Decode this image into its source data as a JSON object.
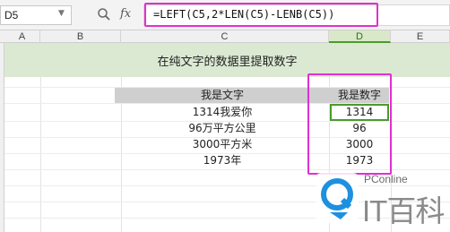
{
  "formula_bar": {
    "name_box": "D5",
    "fx_label": "fx",
    "formula": "=LEFT(C5,2*LEN(C5)-LENB(C5))"
  },
  "columns": [
    "A",
    "B",
    "C",
    "D",
    "E"
  ],
  "banner": "在纯文字的数据里提取数字",
  "table": {
    "header_source": "我是文字",
    "header_result": "我是数字",
    "rows": [
      {
        "source": "1314我爱你",
        "result": "1314"
      },
      {
        "source": "96万平方公里",
        "result": "96"
      },
      {
        "source": "3000平方米",
        "result": "3000"
      },
      {
        "source": "1973年",
        "result": "1973"
      }
    ]
  },
  "colors": {
    "highlight": "#e030d0",
    "selection": "#4b9a2e",
    "banner_bg": "#dbe9d3"
  },
  "watermark": {
    "brand_small": "PConline",
    "brand_big": "IT百科"
  }
}
